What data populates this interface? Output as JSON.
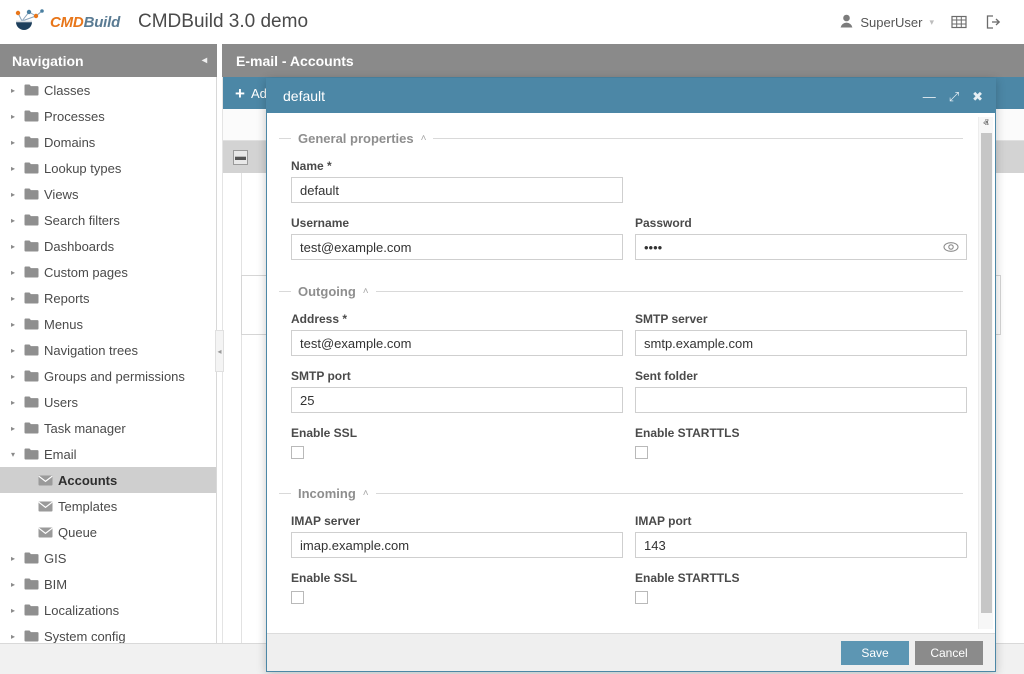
{
  "topbar": {
    "logo_cmd": "CMD",
    "logo_build": "Build",
    "app_title": "CMDBuild 3.0 demo",
    "user_name": "SuperUser",
    "user_icon": "user-icon",
    "caret": "▾",
    "grid_icon": "grid-icon",
    "logout_icon": "logout-icon"
  },
  "navigation": {
    "header": "Navigation",
    "collapse_arrow": "◂",
    "items": [
      {
        "label": "Classes",
        "icon": "folder-icon",
        "twisty": "▸",
        "selected": false,
        "child": false
      },
      {
        "label": "Processes",
        "icon": "folder-icon",
        "twisty": "▸",
        "selected": false,
        "child": false
      },
      {
        "label": "Domains",
        "icon": "folder-icon",
        "twisty": "▸",
        "selected": false,
        "child": false
      },
      {
        "label": "Lookup types",
        "icon": "folder-icon",
        "twisty": "▸",
        "selected": false,
        "child": false
      },
      {
        "label": "Views",
        "icon": "folder-icon",
        "twisty": "▸",
        "selected": false,
        "child": false
      },
      {
        "label": "Search filters",
        "icon": "folder-icon",
        "twisty": "▸",
        "selected": false,
        "child": false
      },
      {
        "label": "Dashboards",
        "icon": "folder-icon",
        "twisty": "▸",
        "selected": false,
        "child": false
      },
      {
        "label": "Custom pages",
        "icon": "folder-icon",
        "twisty": "▸",
        "selected": false,
        "child": false
      },
      {
        "label": "Reports",
        "icon": "folder-icon",
        "twisty": "▸",
        "selected": false,
        "child": false
      },
      {
        "label": "Menus",
        "icon": "folder-icon",
        "twisty": "▸",
        "selected": false,
        "child": false
      },
      {
        "label": "Navigation trees",
        "icon": "folder-icon",
        "twisty": "▸",
        "selected": false,
        "child": false
      },
      {
        "label": "Groups and permissions",
        "icon": "folder-icon",
        "twisty": "▸",
        "selected": false,
        "child": false
      },
      {
        "label": "Users",
        "icon": "folder-icon",
        "twisty": "▸",
        "selected": false,
        "child": false
      },
      {
        "label": "Task manager",
        "icon": "folder-icon",
        "twisty": "▸",
        "selected": false,
        "child": false
      },
      {
        "label": "Email",
        "icon": "folder-icon",
        "twisty": "▾",
        "selected": false,
        "child": false
      },
      {
        "label": "Accounts",
        "icon": "envelope-icon",
        "twisty": "",
        "selected": true,
        "child": true
      },
      {
        "label": "Templates",
        "icon": "envelope-icon",
        "twisty": "",
        "selected": false,
        "child": true
      },
      {
        "label": "Queue",
        "icon": "envelope-icon",
        "twisty": "",
        "selected": false,
        "child": true
      },
      {
        "label": "GIS",
        "icon": "folder-icon",
        "twisty": "▸",
        "selected": false,
        "child": false
      },
      {
        "label": "BIM",
        "icon": "folder-icon",
        "twisty": "▸",
        "selected": false,
        "child": false
      },
      {
        "label": "Localizations",
        "icon": "folder-icon",
        "twisty": "▸",
        "selected": false,
        "child": false
      },
      {
        "label": "System config",
        "icon": "folder-icon",
        "twisty": "▸",
        "selected": false,
        "child": false
      }
    ]
  },
  "tab": {
    "title": "E-mail - Accounts"
  },
  "toolbar": {
    "add_label": "Add",
    "plus": "+"
  },
  "modal": {
    "title": "default",
    "minimize_icon": "minimize-icon",
    "maximize_icon": "maximize-icon",
    "close_icon": "close-icon",
    "minimize_glyph": "—",
    "maximize_glyph": "⤢",
    "close_glyph": "✖",
    "scroll_up_glyph": "ⱏ",
    "scroll_down_glyph": "ⱟ",
    "sections": {
      "general": {
        "title": "General properties",
        "chevron": "˄",
        "name_label": "Name *",
        "name_value": "default",
        "username_label": "Username",
        "username_value": "test@example.com",
        "password_label": "Password",
        "password_value": "••••",
        "password_toggle_icon": "eye-icon"
      },
      "outgoing": {
        "title": "Outgoing",
        "chevron": "˄",
        "address_label": "Address *",
        "address_value": "test@example.com",
        "smtp_server_label": "SMTP server",
        "smtp_server_value": "smtp.example.com",
        "smtp_port_label": "SMTP port",
        "smtp_port_value": "25",
        "sent_folder_label": "Sent folder",
        "sent_folder_value": "",
        "enable_ssl_label": "Enable SSL",
        "enable_ssl_checked": false,
        "enable_starttls_label": "Enable STARTTLS",
        "enable_starttls_checked": false
      },
      "incoming": {
        "title": "Incoming",
        "chevron": "˄",
        "imap_server_label": "IMAP server",
        "imap_server_value": "imap.example.com",
        "imap_port_label": "IMAP port",
        "imap_port_value": "143",
        "enable_ssl_label": "Enable SSL",
        "enable_ssl_checked": false,
        "enable_starttls_label": "Enable STARTTLS",
        "enable_starttls_checked": false
      }
    },
    "save_label": "Save",
    "cancel_label": "Cancel"
  },
  "colors": {
    "accent": "#4c87a6",
    "save": "#5d96b3",
    "cancel": "#8b8b8b",
    "header_gray": "#8a8a8a",
    "logo_orange": "#e8761a",
    "logo_blue": "#5a7b93"
  }
}
